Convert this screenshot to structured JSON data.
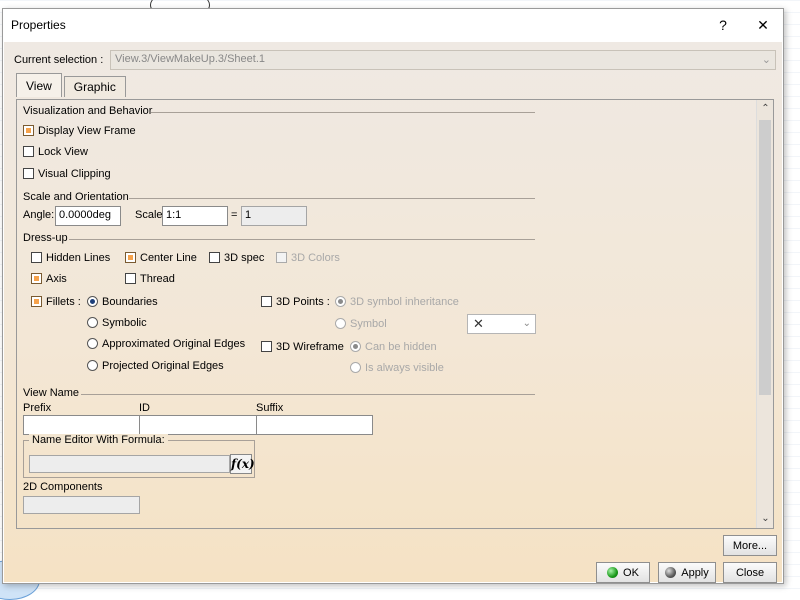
{
  "window": {
    "title": "Properties",
    "help_label": "?",
    "close_label": "✕"
  },
  "current_selection": {
    "label": "Current selection :",
    "value": "View.3/ViewMakeUp.3/Sheet.1"
  },
  "tabs": [
    {
      "label": "View",
      "active": true
    },
    {
      "label": "Graphic",
      "active": false
    }
  ],
  "visualization": {
    "title": "Visualization and Behavior",
    "display_view_frame": {
      "label": "Display View Frame",
      "checked": true
    },
    "lock_view": {
      "label": "Lock View",
      "checked": false
    },
    "visual_clipping": {
      "label": "Visual Clipping",
      "checked": false
    }
  },
  "scale": {
    "title": "Scale and Orientation",
    "angle_label": "Angle:",
    "angle_value": "0.0000deg",
    "scale_label": "Scale:",
    "scale_value": "1:1",
    "equals": "=",
    "result_value": "1"
  },
  "dressup": {
    "title": "Dress-up",
    "hidden_lines": {
      "label": "Hidden Lines",
      "checked": false
    },
    "center_line": {
      "label": "Center Line",
      "checked": true
    },
    "spec_3d": {
      "label": "3D spec",
      "checked": false
    },
    "colors_3d": {
      "label": "3D Colors",
      "checked": false,
      "disabled": true
    },
    "axis": {
      "label": "Axis",
      "checked": true
    },
    "thread": {
      "label": "Thread",
      "checked": false
    },
    "fillets": {
      "label": "Fillets :",
      "checked": true
    },
    "fillet_options": [
      {
        "label": "Boundaries",
        "selected": true
      },
      {
        "label": "Symbolic",
        "selected": false
      },
      {
        "label": "Approximated Original Edges",
        "selected": false
      },
      {
        "label": "Projected Original Edges",
        "selected": false
      }
    ],
    "points_3d": {
      "label": "3D Points :",
      "checked": false
    },
    "points_options": [
      {
        "label": "3D symbol inheritance",
        "selected": true
      },
      {
        "label": "Symbol",
        "selected": false
      }
    ],
    "symbol_select": "✕",
    "wireframe_3d": {
      "label": "3D Wireframe",
      "checked": false
    },
    "wireframe_options": [
      {
        "label": "Can be hidden",
        "selected": true
      },
      {
        "label": "Is always visible",
        "selected": false
      }
    ]
  },
  "view_name": {
    "title": "View Name",
    "prefix_label": "Prefix",
    "id_label": "ID",
    "suffix_label": "Suffix",
    "prefix_value": "",
    "id_value": "",
    "suffix_value": "",
    "formula_title": "Name Editor With Formula:",
    "formula_value": "",
    "fx_label": "f(x)"
  },
  "components": {
    "title": "2D Components",
    "value": ""
  },
  "buttons": {
    "more": "More...",
    "ok": "OK",
    "apply": "Apply",
    "close": "Close"
  }
}
